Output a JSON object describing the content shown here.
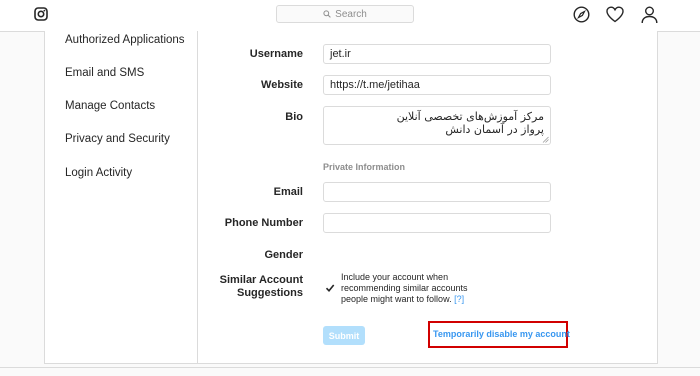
{
  "search": {
    "placeholder": "Search"
  },
  "sidebar": {
    "items": [
      {
        "label": "Authorized Applications"
      },
      {
        "label": "Email and SMS"
      },
      {
        "label": "Manage Contacts"
      },
      {
        "label": "Privacy and Security"
      },
      {
        "label": "Login Activity"
      }
    ]
  },
  "form": {
    "username": {
      "label": "Username",
      "value": "jet.ir"
    },
    "website": {
      "label": "Website",
      "value": "https://t.me/jetihaa"
    },
    "bio": {
      "label": "Bio",
      "line1": "مرکز آموزش‌های تخصصی آنلاین",
      "line2": "پرواز در آسمان دانش"
    },
    "private_info_title": "Private Information",
    "email": {
      "label": "Email",
      "value": ""
    },
    "phone": {
      "label": "Phone Number",
      "value": ""
    },
    "gender": {
      "label": "Gender"
    },
    "similar": {
      "label_line1": "Similar Account",
      "label_line2": "Suggestions",
      "checked": true,
      "text": "Include your account when recommending similar accounts people might want to follow.",
      "help": "[?]"
    },
    "submit_label": "Submit",
    "disable_label": "Temporarily disable my account"
  },
  "colors": {
    "accent": "#3897f0",
    "submit_disabled": "#b2dffc",
    "highlight": "#d10000"
  }
}
